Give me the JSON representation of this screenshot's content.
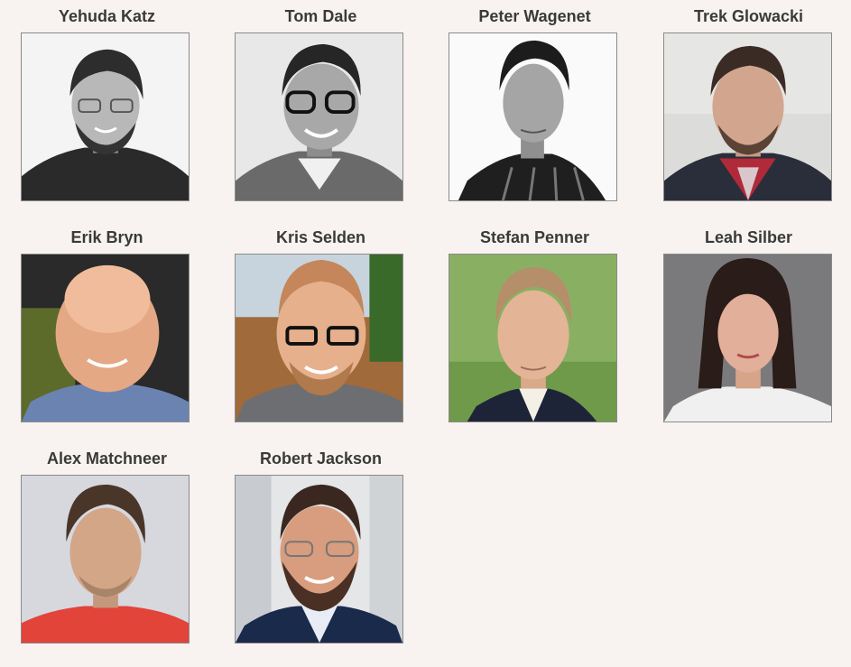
{
  "team": {
    "members": [
      {
        "name": "Yehuda Katz"
      },
      {
        "name": "Tom Dale"
      },
      {
        "name": "Peter Wagenet"
      },
      {
        "name": "Trek Glowacki"
      },
      {
        "name": "Erik Bryn"
      },
      {
        "name": "Kris Selden"
      },
      {
        "name": "Stefan Penner"
      },
      {
        "name": "Leah Silber"
      },
      {
        "name": "Alex Matchneer"
      },
      {
        "name": "Robert Jackson"
      }
    ]
  },
  "colors": {
    "page_background": "#f8f3f0",
    "name_text": "#3a3a3a",
    "photo_border": "#8a8a8a"
  }
}
